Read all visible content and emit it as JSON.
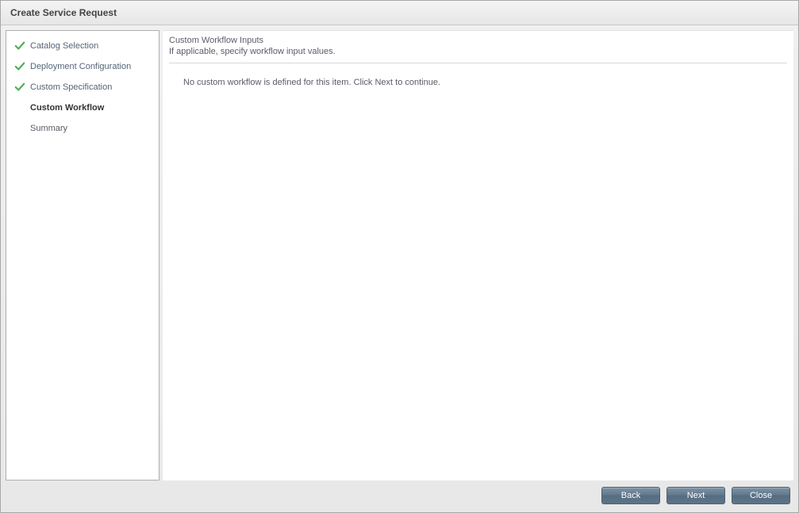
{
  "dialog": {
    "title": "Create Service Request"
  },
  "steps": [
    {
      "label": "Catalog Selection",
      "state": "done"
    },
    {
      "label": "Deployment Configuration",
      "state": "done"
    },
    {
      "label": "Custom Specification",
      "state": "done"
    },
    {
      "label": "Custom Workflow",
      "state": "current"
    },
    {
      "label": "Summary",
      "state": "future"
    }
  ],
  "main": {
    "heading": "Custom Workflow Inputs",
    "subheading": "If applicable, specify workflow input values.",
    "body": "No custom workflow is defined for this item. Click Next to continue."
  },
  "buttons": {
    "back": "Back",
    "next": "Next",
    "close": "Close"
  }
}
